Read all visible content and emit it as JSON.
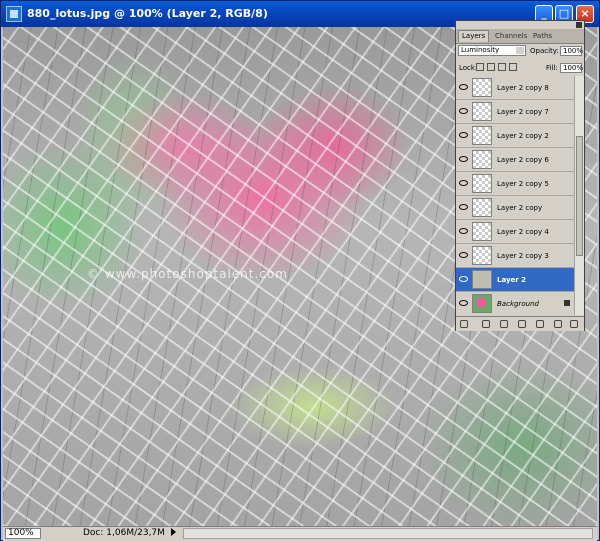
{
  "window": {
    "title": "880_lotus.jpg @ 100% (Layer 2, RGB/8)",
    "minimize": "_",
    "maximize": "□",
    "close": "×"
  },
  "canvas": {
    "watermark": "© www.photoshoptalent.com"
  },
  "status": {
    "zoom": "100%",
    "doc": "Doc: 1,06M/23,7M"
  },
  "layers_panel": {
    "tabs": [
      "Layers",
      "Channels",
      "Paths"
    ],
    "blend_mode": "Luminosity",
    "opacity_label": "Opacity:",
    "opacity_value": "100%",
    "lock_label": "Lock:",
    "fill_label": "Fill:",
    "fill_value": "100%",
    "layers": [
      {
        "name": "Layer 2 copy 8",
        "selected": false
      },
      {
        "name": "Layer 2 copy 7",
        "selected": false
      },
      {
        "name": "Layer 2 copy 2",
        "selected": false
      },
      {
        "name": "Layer 2 copy 6",
        "selected": false
      },
      {
        "name": "Layer 2 copy 5",
        "selected": false
      },
      {
        "name": "Layer 2 copy",
        "selected": false
      },
      {
        "name": "Layer 2 copy 4",
        "selected": false
      },
      {
        "name": "Layer 2 copy 3",
        "selected": false
      },
      {
        "name": "Layer 2",
        "selected": true
      },
      {
        "name": "Background",
        "selected": false
      }
    ]
  },
  "colors": {
    "titlebar": "#0848c0",
    "selection": "#316ac5"
  }
}
